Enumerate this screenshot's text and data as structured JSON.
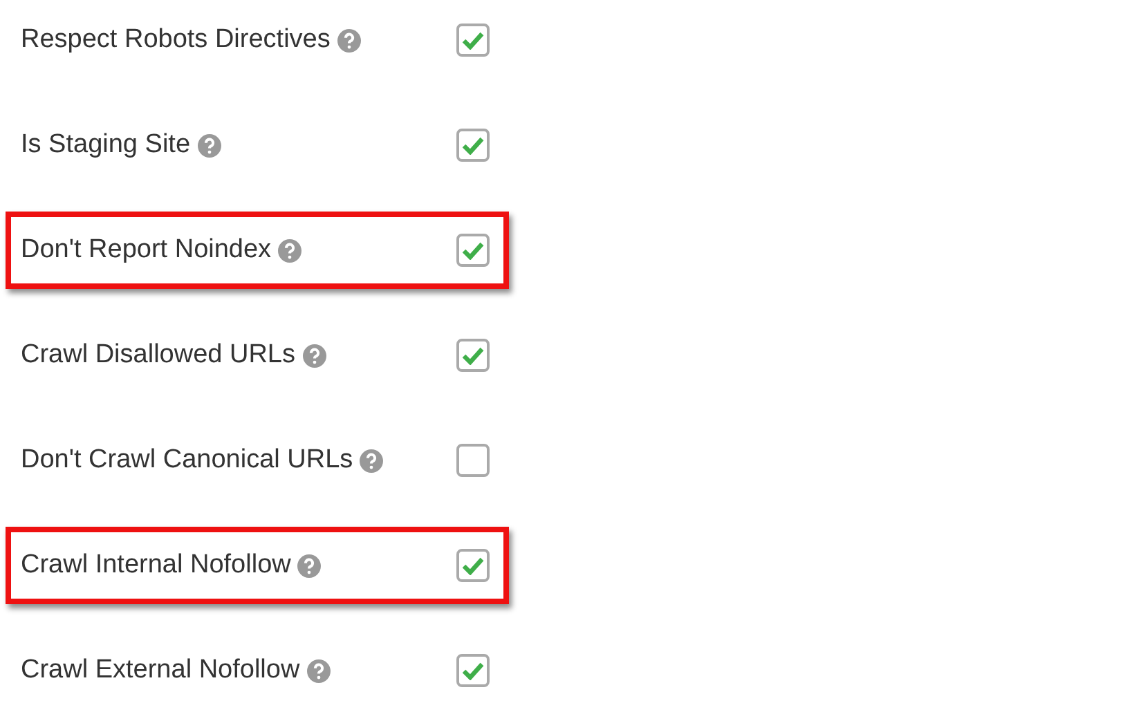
{
  "settings": [
    {
      "label": "Respect Robots Directives",
      "checked": true,
      "highlighted": false
    },
    {
      "label": "Is Staging Site",
      "checked": true,
      "highlighted": false
    },
    {
      "label": "Don't Report Noindex",
      "checked": true,
      "highlighted": true
    },
    {
      "label": "Crawl Disallowed URLs",
      "checked": true,
      "highlighted": false
    },
    {
      "label": "Don't Crawl Canonical URLs",
      "checked": false,
      "highlighted": false
    },
    {
      "label": "Crawl Internal Nofollow",
      "checked": true,
      "highlighted": true
    },
    {
      "label": "Crawl External Nofollow",
      "checked": true,
      "highlighted": false
    }
  ]
}
